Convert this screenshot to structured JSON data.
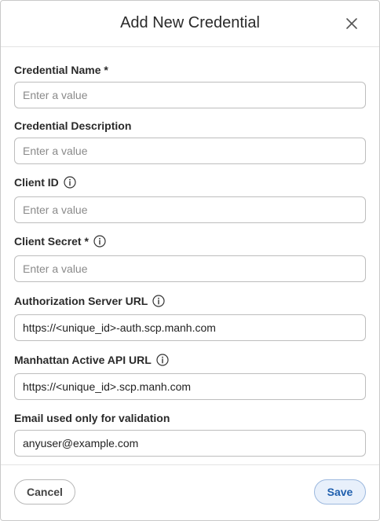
{
  "dialog": {
    "title": "Add New Credential",
    "close_icon": "close-icon"
  },
  "form": {
    "credential_name": {
      "label": "Credential Name *",
      "placeholder": "Enter a value",
      "value": ""
    },
    "credential_description": {
      "label": "Credential Description",
      "placeholder": "Enter a value",
      "value": ""
    },
    "client_id": {
      "label": "Client ID",
      "placeholder": "Enter a value",
      "value": "",
      "info_icon": "info-icon"
    },
    "client_secret": {
      "label": "Client Secret *",
      "placeholder": "Enter a value",
      "value": "",
      "info_icon": "info-icon"
    },
    "auth_server_url": {
      "label": "Authorization Server URL",
      "value": "https://<unique_id>-auth.scp.manh.com",
      "info_icon": "info-icon"
    },
    "manhattan_api_url": {
      "label": "Manhattan Active API URL",
      "value": "https://<unique_id>.scp.manh.com",
      "info_icon": "info-icon"
    },
    "validation_email": {
      "label": "Email used only for validation",
      "value": "anyuser@example.com"
    }
  },
  "footer": {
    "cancel_label": "Cancel",
    "save_label": "Save"
  },
  "colors": {
    "save_text": "#1f5fae",
    "save_background": "#e8f0fb",
    "border": "#bdbdbd"
  }
}
